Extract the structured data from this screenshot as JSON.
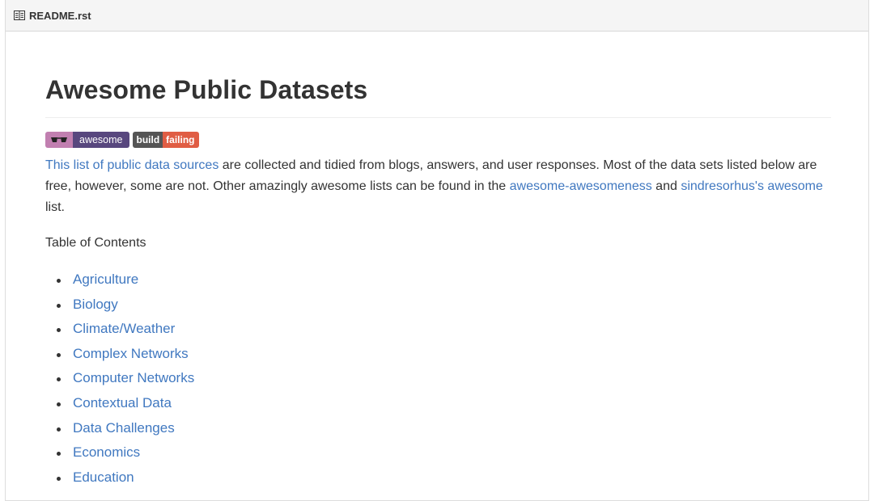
{
  "header": {
    "filename": "README.rst",
    "icon": "book-icon"
  },
  "title": "Awesome Public Datasets",
  "badges": {
    "awesome_label": "awesome",
    "build_left": "build",
    "build_right": "failing",
    "colors": {
      "awesome_left": "#c17fb0",
      "awesome_right": "#58477e",
      "build_left": "#555555",
      "build_right": "#e05d44"
    }
  },
  "intro": {
    "link1": "This list of public data sources",
    "text1": " are collected and tidied from blogs, answers, and user responses. Most of the data sets listed below are free, however, some are not. Other amazingly awesome lists can be found in the ",
    "link2": "awesome-awesomeness",
    "text2": " and ",
    "link3": "sindresorhus's awesome",
    "text3": " list."
  },
  "toc_title": "Table of Contents",
  "toc": [
    "Agriculture",
    "Biology",
    "Climate/Weather",
    "Complex Networks",
    "Computer Networks",
    "Contextual Data",
    "Data Challenges",
    "Economics",
    "Education"
  ],
  "colors": {
    "link": "#4078c0",
    "text": "#333333"
  }
}
